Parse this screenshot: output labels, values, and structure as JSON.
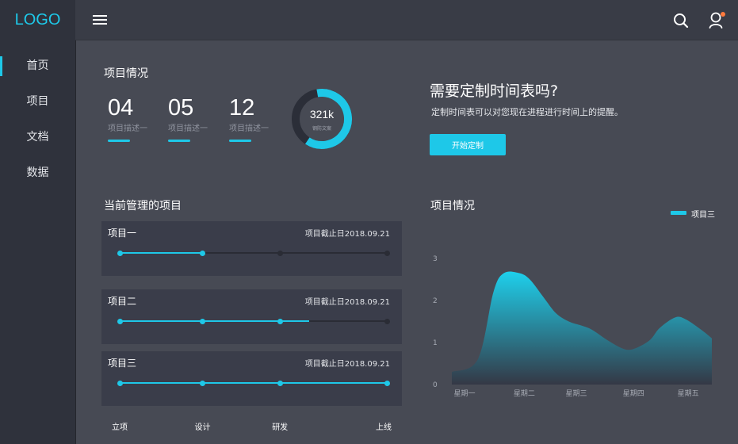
{
  "app": {
    "logo": "LOGO"
  },
  "sidebar": {
    "items": [
      {
        "label": "首页",
        "active": true
      },
      {
        "label": "项目",
        "active": false
      },
      {
        "label": "文档",
        "active": false
      },
      {
        "label": "数据",
        "active": false
      }
    ]
  },
  "topbar": {
    "icons": [
      "menu-icon",
      "search-icon",
      "user-icon"
    ],
    "notification_color": "#ff7a3d"
  },
  "overview": {
    "title": "项目情况",
    "stats": [
      {
        "value": "04",
        "label": "项目描述一"
      },
      {
        "value": "05",
        "label": "项目描述一"
      },
      {
        "value": "12",
        "label": "项目描述一"
      }
    ],
    "donut": {
      "value": "321k",
      "caption": "钢防文案",
      "fraction": 0.62
    }
  },
  "promo": {
    "title": "需要定制时间表吗?",
    "description": "定制时间表可以对您现在进程进行时间上的提醒。",
    "button_label": "开始定制"
  },
  "projects": {
    "title": "当前管理的项目",
    "stages": [
      "立项",
      "设计",
      "研发",
      "上线"
    ],
    "items": [
      {
        "name": "项目一",
        "deadline": "项目截止日2018.09.21",
        "progress": 0.31
      },
      {
        "name": "项目二",
        "deadline": "项目截止日2018.09.21",
        "progress": 0.71
      },
      {
        "name": "项目三",
        "deadline": "项目截止日2018.09.21",
        "progress": 1.0
      }
    ]
  },
  "chart_data": {
    "type": "area",
    "title": "项目情况",
    "categories": [
      "星期一",
      "星期二",
      "星期三",
      "星期四",
      "星期五"
    ],
    "x": [
      0,
      1,
      1.6,
      2,
      2.6,
      3,
      3.5,
      4,
      4.5,
      5,
      5.4,
      6,
      6.6,
      7,
      7.6,
      8,
      8.6,
      9,
      9.6,
      10
    ],
    "series": [
      {
        "name": "项目三",
        "values": [
          0.3,
          0.6,
          2.2,
          2.65,
          2.65,
          2.5,
          2.1,
          1.7,
          1.5,
          1.4,
          1.3,
          1.05,
          0.85,
          0.85,
          1.05,
          1.35,
          1.6,
          1.55,
          1.3,
          1.1
        ]
      }
    ],
    "xlim": [
      0,
      10
    ],
    "ylim": [
      0,
      3
    ],
    "yticks": [
      "0",
      "1",
      "2",
      "3"
    ],
    "legend": "top-right",
    "grid": false,
    "colors": {
      "area_top": "#1ed0ec",
      "area_bottom": "#343845"
    }
  }
}
